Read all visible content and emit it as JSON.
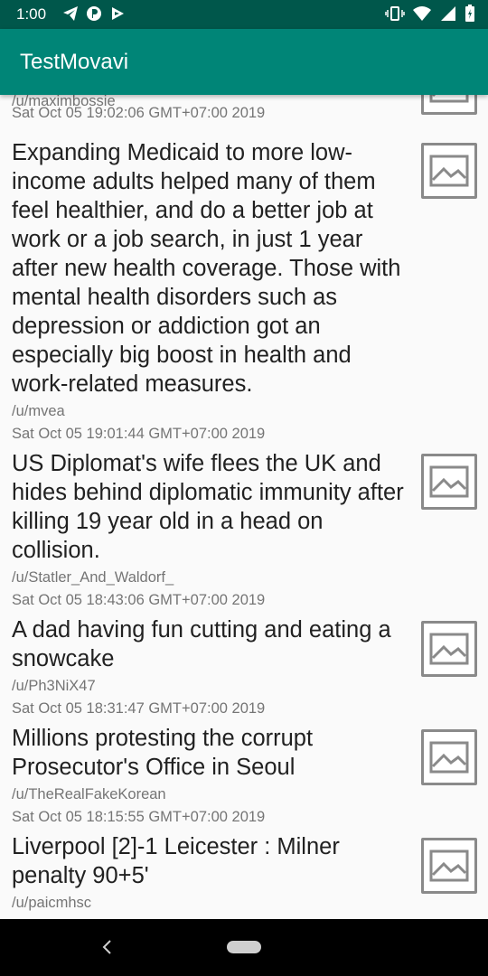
{
  "status_bar": {
    "time": "1:00",
    "notification_icons": [
      "telegram-icon",
      "p-app-icon",
      "play-icon"
    ],
    "system_icons": [
      "vibrate-icon",
      "wifi-icon",
      "signal-icon",
      "battery-icon"
    ]
  },
  "app_bar": {
    "title": "TestMovavi",
    "color": "#008577"
  },
  "posts": [
    {
      "title": "",
      "author": "/u/maximbossie",
      "date": "Sat Oct 05 19:02:06 GMT+07:00 2019"
    },
    {
      "title": "Expanding Medicaid to more low-income adults helped many of them feel healthier, and do a better job at work or a job search, in just 1 year after new health coverage. Those with mental health disorders such as depression or addiction got an especially big boost in health and work-related measures.",
      "author": "/u/mvea",
      "date": "Sat Oct 05 19:01:44 GMT+07:00 2019"
    },
    {
      "title": "US Diplomat's wife flees the UK and hides behind diplomatic immunity after killing 19 year old in a head on collision.",
      "author": "/u/Statler_And_Waldorf_",
      "date": "Sat Oct 05 18:43:06 GMT+07:00 2019"
    },
    {
      "title": "A dad having fun cutting and eating a snowcake",
      "author": "/u/Ph3NiX47",
      "date": "Sat Oct 05 18:31:47 GMT+07:00 2019"
    },
    {
      "title": "Millions protesting the corrupt Prosecutor's Office in Seoul",
      "author": "/u/TheRealFakeKorean",
      "date": "Sat Oct 05 18:15:55 GMT+07:00 2019"
    },
    {
      "title": "Liverpool [2]-1 Leicester : Milner penalty 90+5'",
      "author": "/u/paicmhsc",
      "date": ""
    }
  ],
  "nav_bar": {
    "icons": [
      "back-icon",
      "home-pill-icon"
    ]
  }
}
